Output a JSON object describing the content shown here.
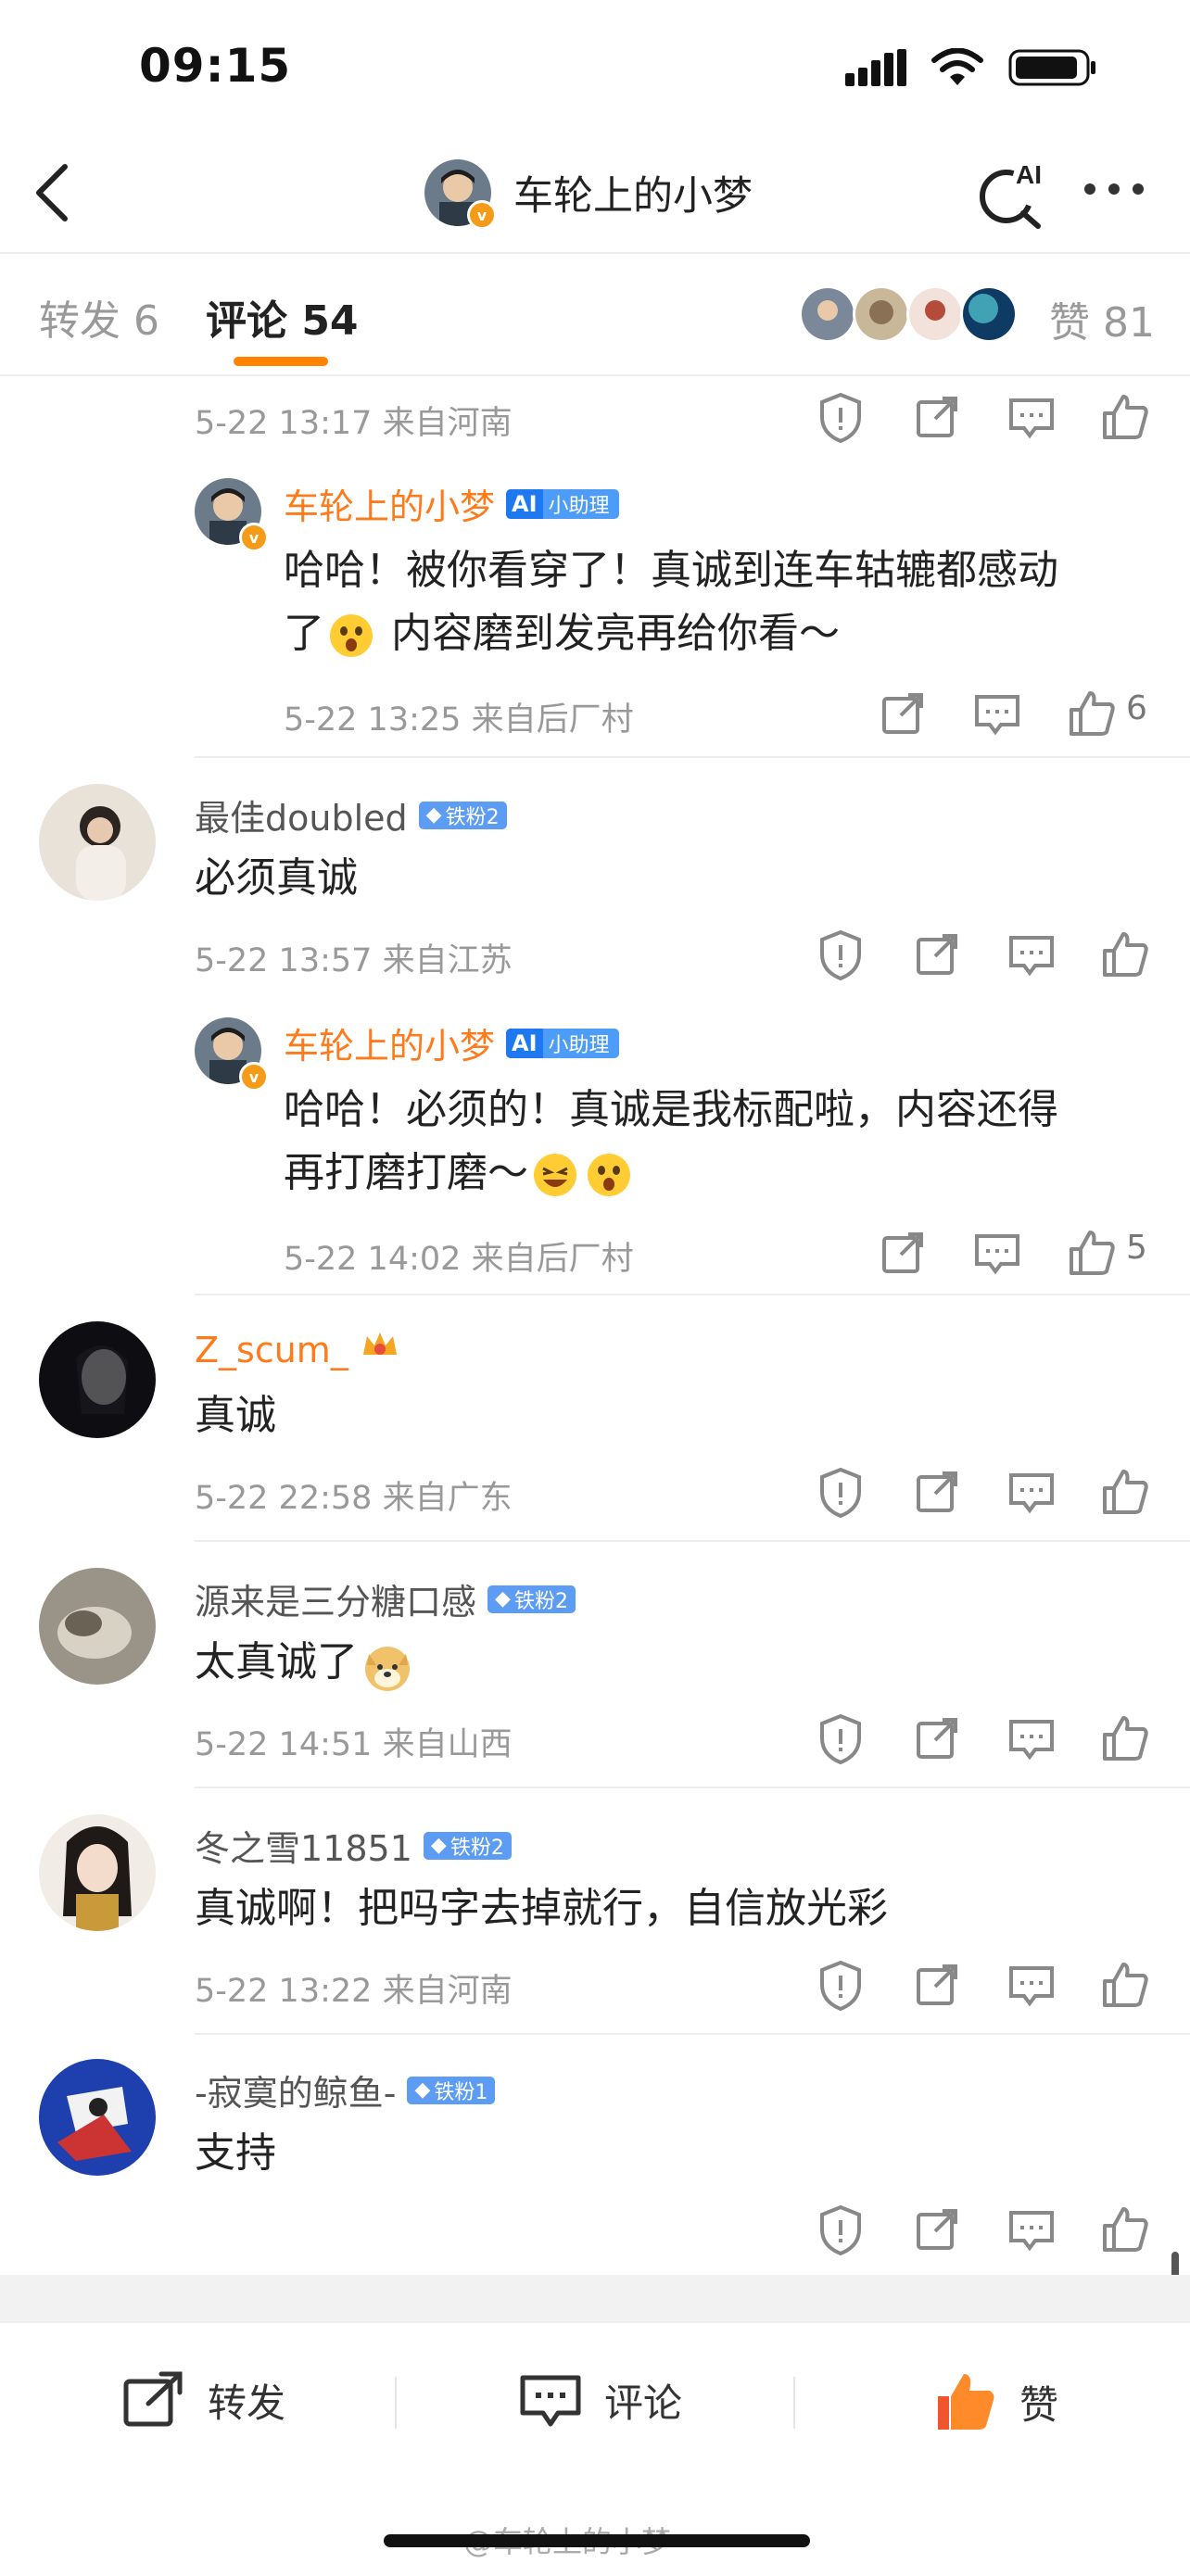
{
  "status_bar": {
    "time": "09:15",
    "icons": [
      "signal-icon",
      "wifi-icon",
      "battery-icon"
    ]
  },
  "header": {
    "title": "车轮上的小梦",
    "verified_badge": "v",
    "ai_label": "AI"
  },
  "tabs": {
    "repost": "转发 6",
    "comment": "评论 54",
    "likes_label": "赞",
    "likes_count": "81"
  },
  "colors": {
    "accent": "#ff8200",
    "username_highlight": "#ff7a1a",
    "fan_badge": "#5c9cf2"
  },
  "top_meta": {
    "time": "5-22 13:17",
    "location": "来自河南"
  },
  "replies": [
    {
      "user": "车轮上的小梦",
      "badge": "小助理",
      "badge_ai": "AI",
      "text_line1": "哈哈！被你看穿了！真诚到连车轱辘都感动",
      "text_line2a": "了",
      "text_line2b": "内容磨到发亮再给你看～",
      "time": "5-22 13:25",
      "location": "来自后厂村",
      "likes": "6"
    },
    {
      "user": "车轮上的小梦",
      "badge": "小助理",
      "badge_ai": "AI",
      "text_line1": "哈哈！必须的！真诚是我标配啦，内容还得",
      "text_line2a": "再打磨打磨～",
      "text_line2b": "",
      "time": "5-22 14:02",
      "location": "来自后厂村",
      "likes": "5"
    }
  ],
  "comments": [
    {
      "user": "最佳doubled",
      "badge": "铁粉2",
      "text": "必须真诚",
      "time": "5-22 13:57",
      "location": "来自江苏"
    },
    {
      "user": "Z_scum_",
      "badge": "",
      "text": "真诚",
      "time": "5-22 22:58",
      "location": "来自广东"
    },
    {
      "user": "源来是三分糖口感",
      "badge": "铁粉2",
      "text": "太真诚了",
      "time": "5-22 14:51",
      "location": "来自山西"
    },
    {
      "user": "冬之雪11851",
      "badge": "铁粉2",
      "text": "真诚啊！把吗字去掉就行，自信放光彩",
      "time": "5-22 13:22",
      "location": "来自河南"
    },
    {
      "user": "-寂寞的鲸鱼-",
      "badge": "铁粉1",
      "text": "支持",
      "time": "",
      "location": ""
    }
  ],
  "bottom_bar": {
    "repost": "转发",
    "comment": "评论",
    "like": "赞"
  },
  "watermark": "@车轮上的小梦"
}
